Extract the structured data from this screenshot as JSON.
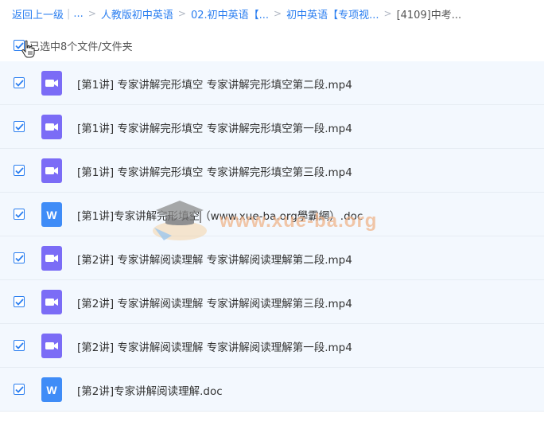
{
  "breadcrumb": {
    "back": "返回上一级",
    "ellipsis": "...",
    "items": [
      "人教版初中英语",
      "02.初中英语【...",
      "初中英语【专项视...",
      "[4109]中考..."
    ]
  },
  "selection": {
    "text": "已选中8个文件/文件夹"
  },
  "files": [
    {
      "name": "[第1讲] 专家讲解完形填空 专家讲解完形填空第二段.mp4",
      "type": "video"
    },
    {
      "name": "[第1讲] 专家讲解完形填空 专家讲解完形填空第一段.mp4",
      "type": "video"
    },
    {
      "name": "[第1讲] 专家讲解完形填空 专家讲解完形填空第三段.mp4",
      "type": "video"
    },
    {
      "name": "[第1讲]专家讲解完形填空（www.xue-ba.org學霸網）.doc",
      "type": "word"
    },
    {
      "name": "[第2讲] 专家讲解阅读理解 专家讲解阅读理解第二段.mp4",
      "type": "video"
    },
    {
      "name": "[第2讲] 专家讲解阅读理解 专家讲解阅读理解第三段.mp4",
      "type": "video"
    },
    {
      "name": "[第2讲] 专家讲解阅读理解 专家讲解阅读理解第一段.mp4",
      "type": "video"
    },
    {
      "name": "[第2讲]专家讲解阅读理解.doc",
      "type": "word"
    }
  ],
  "icons": {
    "video": "video-file-icon",
    "word": "word-file-icon",
    "word_letter": "W"
  },
  "watermark": {
    "text": "www.xue-ba.org"
  },
  "colors": {
    "accent": "#2a7ef0",
    "video_icon": "#7b6cf6",
    "word_icon": "#3f8cf7",
    "row_bg": "#f3f8fe",
    "row_border": "#e6ecf3"
  }
}
